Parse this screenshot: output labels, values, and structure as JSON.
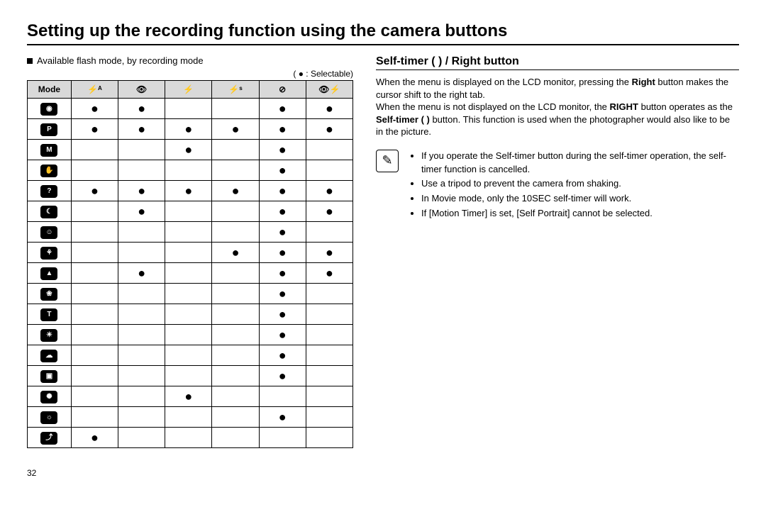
{
  "title": "Setting up the recording function using the camera buttons",
  "left": {
    "subhead": "Available flash mode, by recording mode",
    "legend": "( ● : Selectable)",
    "table": {
      "mode_label": "Mode",
      "col_icons": [
        "flash-auto-icon",
        "redeye-icon",
        "fillin-flash-icon",
        "slow-sync-icon",
        "flash-off-icon",
        "redeye-fix-icon"
      ],
      "col_glyphs": [
        "⚡ᴬ",
        "👁",
        "⚡",
        "⚡ˢ",
        "⊘",
        "👁⚡"
      ],
      "row_icons": [
        "mode-auto",
        "mode-program",
        "mode-manual",
        "mode-dis",
        "mode-photo-help",
        "mode-night",
        "mode-portrait",
        "mode-children",
        "mode-landscape",
        "mode-closeup",
        "mode-text",
        "mode-sunset",
        "mode-dawn",
        "mode-backlight",
        "mode-firework",
        "mode-beach-snow",
        "mode-self-shot"
      ],
      "row_glyphs": [
        "◉",
        "P",
        "M",
        "✋",
        "?",
        "☾",
        "☺",
        "⚘",
        "▲",
        "❀",
        "T",
        "☀",
        "☁",
        "▣",
        "✺",
        "☼",
        "⤴"
      ],
      "data": [
        [
          1,
          1,
          0,
          0,
          1,
          1
        ],
        [
          1,
          1,
          1,
          1,
          1,
          1
        ],
        [
          0,
          0,
          1,
          0,
          1,
          0
        ],
        [
          0,
          0,
          0,
          0,
          1,
          0
        ],
        [
          1,
          1,
          1,
          1,
          1,
          1
        ],
        [
          0,
          1,
          0,
          0,
          1,
          1
        ],
        [
          0,
          0,
          0,
          0,
          1,
          0
        ],
        [
          0,
          0,
          0,
          1,
          1,
          1
        ],
        [
          0,
          1,
          0,
          0,
          1,
          1
        ],
        [
          0,
          0,
          0,
          0,
          1,
          0
        ],
        [
          0,
          0,
          0,
          0,
          1,
          0
        ],
        [
          0,
          0,
          0,
          0,
          1,
          0
        ],
        [
          0,
          0,
          0,
          0,
          1,
          0
        ],
        [
          0,
          0,
          0,
          0,
          1,
          0
        ],
        [
          0,
          0,
          1,
          0,
          0,
          0
        ],
        [
          0,
          0,
          0,
          0,
          1,
          0
        ],
        [
          1,
          0,
          0,
          0,
          0,
          0
        ]
      ]
    }
  },
  "right": {
    "section_title": "Self-timer ( ) / Right button",
    "para1_a": "When the menu is displayed on the LCD monitor, pressing the ",
    "para1_b": "Right",
    "para1_c": " button makes the cursor shift to the right tab.",
    "para2_a": "When the menu is not displayed on the LCD monitor, the ",
    "para2_b": "RIGHT",
    "para2_c": " button operates as the ",
    "para2_d": "Self-timer ( )",
    "para2_e": " button. This function is used when the photographer would also like to be in the picture.",
    "note_icon": "✎",
    "notes": [
      "If you operate the Self-timer button during the self-timer operation, the self-timer function is cancelled.",
      "Use a tripod to prevent the camera from shaking.",
      "In Movie mode, only the 10SEC self-timer will work.",
      "If [Motion Timer] is set, [Self Portrait] cannot be selected."
    ]
  },
  "page_number": "32"
}
